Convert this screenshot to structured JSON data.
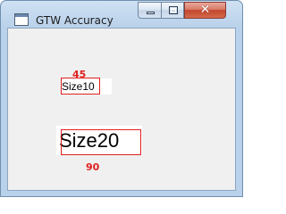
{
  "window": {
    "title": "GTW Accuracy",
    "icon": "app-window-icon",
    "controls": {
      "minimize": "minimize-icon",
      "maximize": "maximize-icon",
      "close": "close-icon",
      "close_glyph": "✕"
    }
  },
  "client": {
    "labels": {
      "top_value": "45",
      "bottom_value": "90"
    },
    "text_boxes": {
      "small": "Size10",
      "large": "Size20"
    },
    "colors": {
      "marker": "#e02020",
      "background": "#f0f0f0"
    }
  }
}
